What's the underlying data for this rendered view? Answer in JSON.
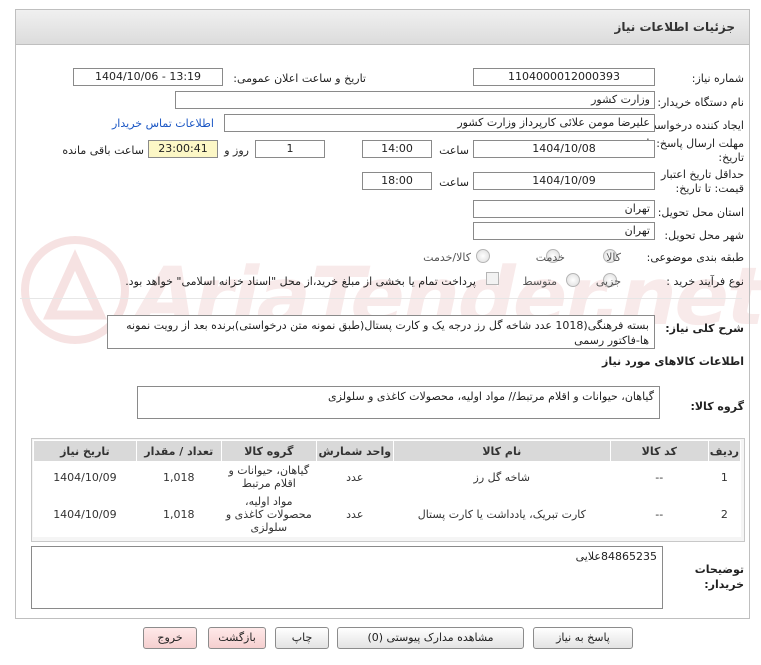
{
  "header": {
    "title": "جزئیات اطلاعات نیاز"
  },
  "watermark": {
    "text": "AriaTender.net"
  },
  "fields": {
    "need_number_label": "شماره نیاز:",
    "need_number": "1104000012000393",
    "announce_label": "تاریخ و ساعت اعلان عمومی:",
    "announce_value": "1404/10/06 - 13:19",
    "buyer_org_label": "نام دستگاه خریدار:",
    "buyer_org": "وزارت کشور",
    "requester_label": "ایجاد کننده درخواست:",
    "requester": "علیرضا مومن علائی کارپرداز وزارت کشور",
    "contact_link": "اطلاعات تماس خریدار",
    "reply_deadline_label": "مهلت ارسال پاسخ: تا تاریخ:",
    "reply_date": "1404/10/08",
    "time_label": "ساعت",
    "reply_time": "14:00",
    "days_value": "1",
    "days_label": "روز و",
    "remaining_time": "23:00:41",
    "remaining_label": "ساعت باقی مانده",
    "price_validity_label": "حداقل تاریخ اعتبار قیمت: تا تاریخ:",
    "validity_date": "1404/10/09",
    "validity_time": "18:00",
    "province_label": "استان محل تحویل:",
    "province": "تهران",
    "city_label": "شهر محل تحویل:",
    "city": "تهران",
    "category_label": "طبقه بندی موضوعی:",
    "category_options": [
      "کالا",
      "خدمت",
      "کالا/خدمت"
    ],
    "process_label": "نوع فرآیند خرید :",
    "process_options": [
      "جزیی",
      "متوسط"
    ],
    "payment_note": "پرداخت تمام یا بخشی از مبلغ خرید،از محل \"اسناد خزانه اسلامی\" خواهد بود.",
    "description_label": "شرح کلی نیاز:",
    "description": "بسته فرهنگی(1018 عدد شاخه گل رز درجه یک و کارت پستال(طبق نمونه متن درخواستی)برنده بعد از رویت نمونه ها-فاکتور رسمی",
    "goods_info_title": "اطلاعات کالاهای مورد نیاز",
    "goods_group_label": "گروه کالا:",
    "goods_group": "گیاهان، حیوانات و اقلام مرتبط// مواد اولیه، محصولات کاغذی و سلولزی",
    "buyer_notes_label": "توضیحات خریدار:",
    "buyer_notes": "84865235علایی"
  },
  "table": {
    "headers": [
      "ردیف",
      "کد کالا",
      "نام کالا",
      "واحد شمارش",
      "گروه کالا",
      "تعداد / مقدار",
      "تاریخ نیاز"
    ],
    "rows": [
      [
        "1",
        "--",
        "شاخه گل رز",
        "عدد",
        "گیاهان، حیوانات و اقلام مرتبط",
        "1,018",
        "1404/10/09"
      ],
      [
        "2",
        "--",
        "کارت تبریک، یادداشت یا کارت پستال",
        "عدد",
        "مواد اولیه، محصولات کاغذی و سلولزی",
        "1,018",
        "1404/10/09"
      ]
    ]
  },
  "buttons": {
    "reply": "پاسخ به نیاز",
    "attachments": "مشاهده مدارک پیوستی (0)",
    "print": "چاپ",
    "back": "بازگشت",
    "exit": "خروج"
  }
}
